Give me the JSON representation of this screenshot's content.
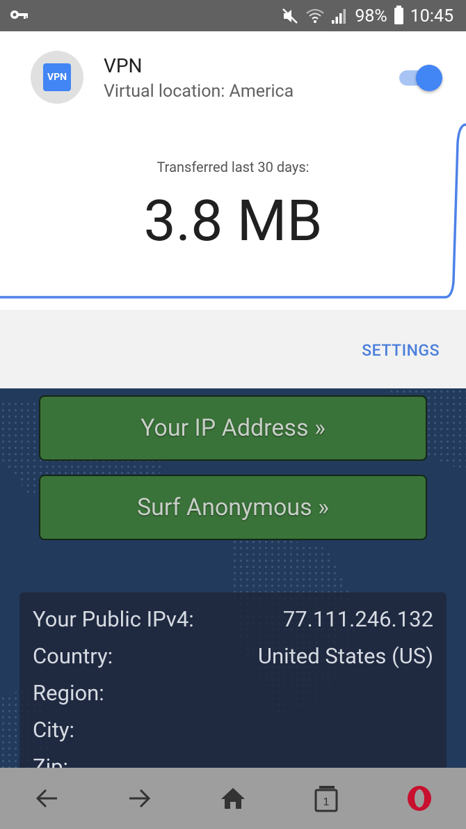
{
  "status_bar": {
    "battery": "98%",
    "time": "10:45",
    "icons": [
      "vpn-key-icon",
      "mute-icon",
      "wifi-icon",
      "signal-icon",
      "battery-icon"
    ]
  },
  "vpn": {
    "title": "VPN",
    "location": "Virtual location: America",
    "enabled": true,
    "transfer_label": "Transferred last 30 days:",
    "transfer_value": "3.8 MB"
  },
  "settings": {
    "label": "SETTINGS"
  },
  "web": {
    "buttons": [
      "Your IP Address »",
      "Surf Anonymous »"
    ],
    "info_rows": [
      {
        "label": "Your Public IPv4:",
        "value": "77.111.246.132"
      },
      {
        "label": "Country:",
        "value": "United States (US)"
      },
      {
        "label": "Region:",
        "value": ""
      },
      {
        "label": "City:",
        "value": ""
      },
      {
        "label": "Zip:",
        "value": ""
      }
    ]
  },
  "bottom_nav": {
    "items": [
      "back-icon",
      "forward-icon",
      "home-icon",
      "tabs-icon",
      "opera-menu-icon"
    ],
    "tab_count": "1"
  },
  "colors": {
    "accent": "#4285f4",
    "settings": "#4a7fdc",
    "button_green": "#3a7339",
    "page_bg": "#223a5c"
  }
}
